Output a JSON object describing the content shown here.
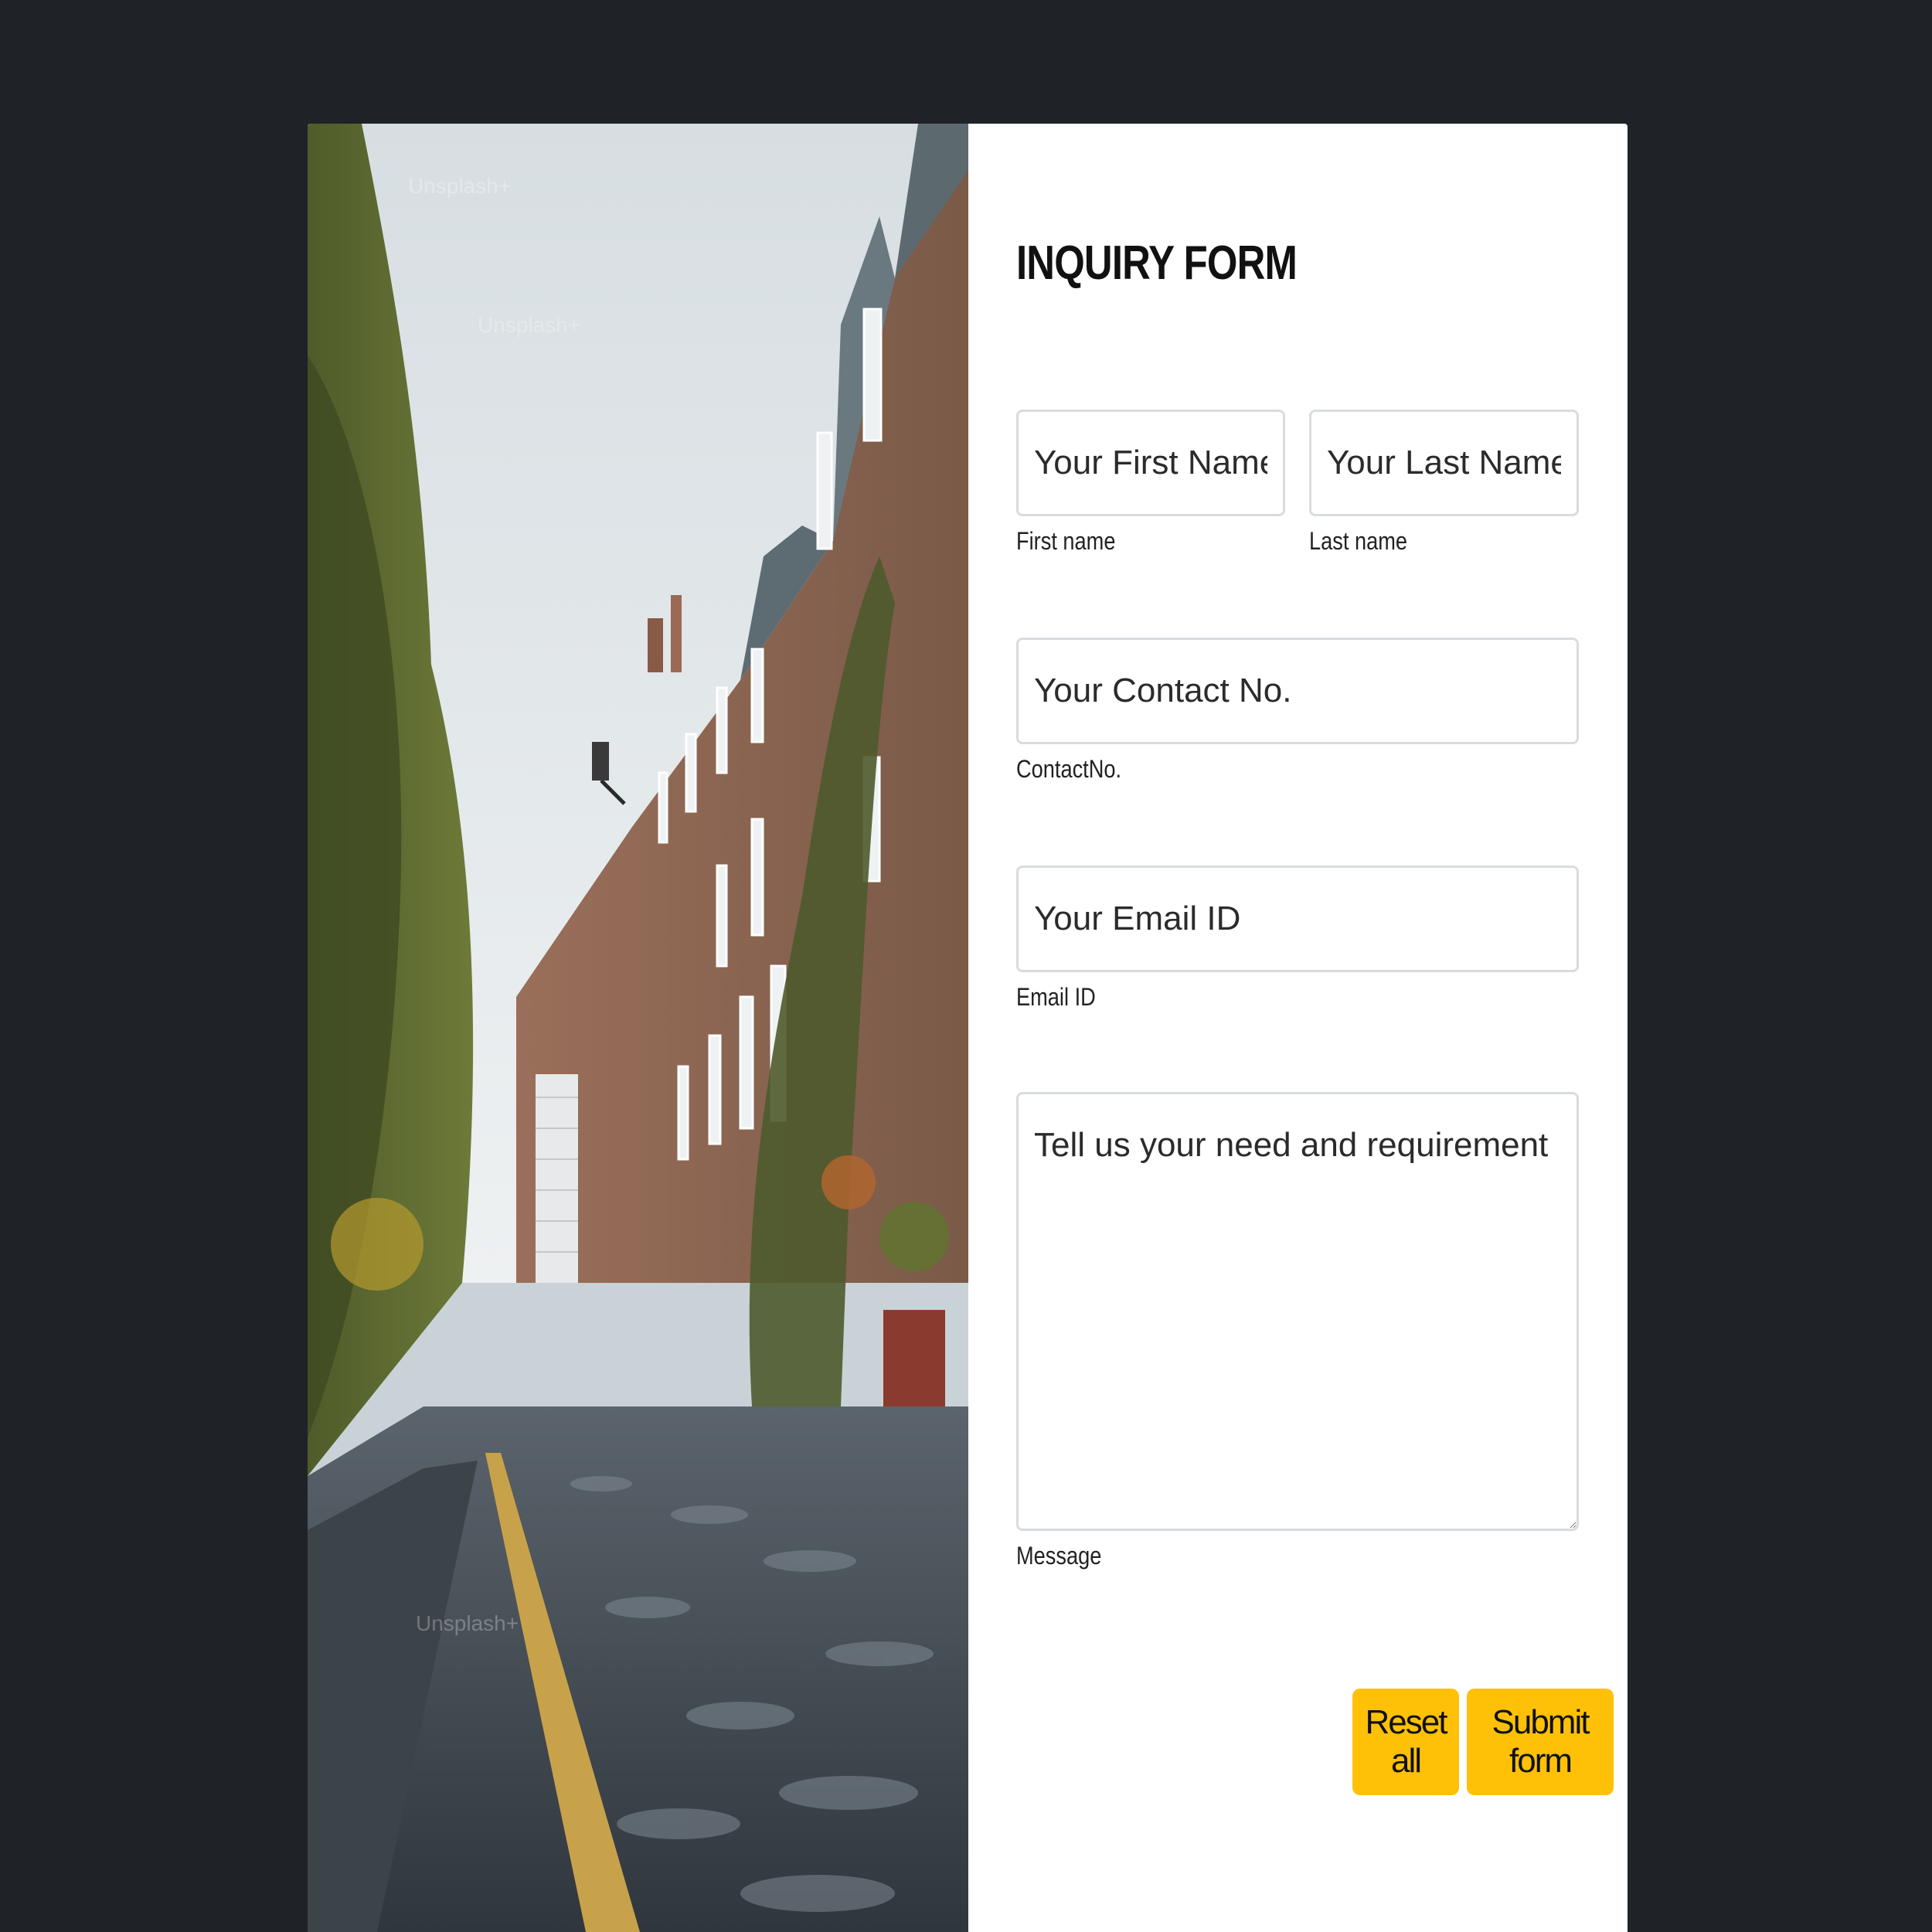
{
  "form": {
    "title": "INQUIRY FORM",
    "first_name": {
      "placeholder": "Your First Name",
      "label": "First name"
    },
    "last_name": {
      "placeholder": "Your Last Name",
      "label": "Last name"
    },
    "contact": {
      "placeholder": "Your Contact No.",
      "label": "ContactNo."
    },
    "email": {
      "placeholder": "Your Email ID",
      "label": "Email ID"
    },
    "message": {
      "placeholder": "Tell us your need and requirement",
      "label": "Message"
    },
    "buttons": {
      "reset": "Reset all",
      "submit": "Submit form"
    }
  },
  "photo": {
    "alt": "Cobblestone lane lined with brick townhouses and ivy",
    "watermark": "Unsplash+"
  },
  "colors": {
    "background": "#1f2227",
    "card": "#ffffff",
    "button": "#ffc107",
    "field_border": "#d9dcdf"
  }
}
